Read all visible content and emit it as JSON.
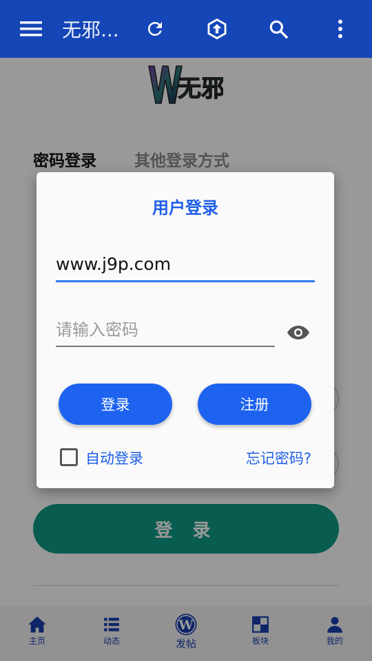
{
  "appbar": {
    "title": "无邪...",
    "icons": [
      "menu-icon",
      "refresh-icon",
      "upload-icon",
      "search-icon",
      "more-vert-icon"
    ],
    "color": "#1546b8"
  },
  "logo_text": "W无邪",
  "tabs": {
    "password_login": "密码登录",
    "other_login": "其他登录方式"
  },
  "background_login_button": "登 录",
  "bottom_nav": {
    "items": [
      {
        "label": "主页",
        "icon": "home-icon"
      },
      {
        "label": "动态",
        "icon": "list-icon"
      },
      {
        "label": "发帖",
        "icon": "wordpress-icon"
      },
      {
        "label": "板块",
        "icon": "grid-icon"
      },
      {
        "label": "我的",
        "icon": "person-icon"
      }
    ]
  },
  "dialog": {
    "title": "用户登录",
    "username_value": "www.j9p.com",
    "password_placeholder": "请输入密码",
    "login_button": "登录",
    "register_button": "注册",
    "auto_login_label": "自动登录",
    "forgot_password": "忘记密码?",
    "accent_color": "#1e63f0"
  }
}
